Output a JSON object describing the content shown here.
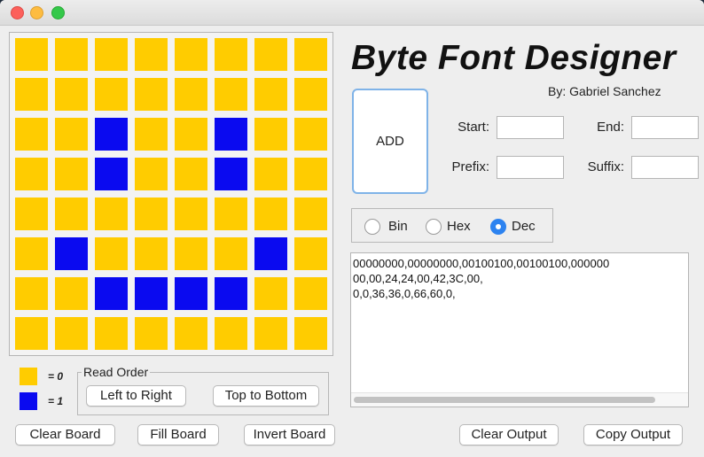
{
  "app_title": "Byte Font Designer",
  "author": "By: Gabriel Sanchez",
  "colors": {
    "zero": "#ffcc00",
    "one": "#0a0af0",
    "selected_radio": "#2d83f0"
  },
  "grid": {
    "rows": 8,
    "cols": 8,
    "bits": [
      [
        0,
        0,
        0,
        0,
        0,
        0,
        0,
        0
      ],
      [
        0,
        0,
        0,
        0,
        0,
        0,
        0,
        0
      ],
      [
        0,
        0,
        1,
        0,
        0,
        1,
        0,
        0
      ],
      [
        0,
        0,
        1,
        0,
        0,
        1,
        0,
        0
      ],
      [
        0,
        0,
        0,
        0,
        0,
        0,
        0,
        0
      ],
      [
        0,
        1,
        0,
        0,
        0,
        0,
        1,
        0
      ],
      [
        0,
        0,
        1,
        1,
        1,
        1,
        0,
        0
      ],
      [
        0,
        0,
        0,
        0,
        0,
        0,
        0,
        0
      ]
    ]
  },
  "legend": {
    "zero_label": "= 0",
    "one_label": "= 1"
  },
  "read_order": {
    "title": "Read Order",
    "left_to_right": "Left to Right",
    "top_to_bottom": "Top to Bottom"
  },
  "buttons": {
    "add": "ADD",
    "clear_board": "Clear Board",
    "fill_board": "Fill Board",
    "invert_board": "Invert Board",
    "clear_output": "Clear Output",
    "copy_output": "Copy Output"
  },
  "fields": {
    "start_label": "Start:",
    "end_label": "End:",
    "prefix_label": "Prefix:",
    "suffix_label": "Suffix:",
    "start_value": "",
    "end_value": "",
    "prefix_value": "",
    "suffix_value": ""
  },
  "format": {
    "options": [
      "Bin",
      "Hex",
      "Dec"
    ],
    "selected": "Dec"
  },
  "output": {
    "lines": [
      "00000000,00000000,00100100,00100100,000000",
      "00,00,24,24,00,42,3C,00,",
      "0,0,36,36,0,66,60,0,"
    ]
  }
}
